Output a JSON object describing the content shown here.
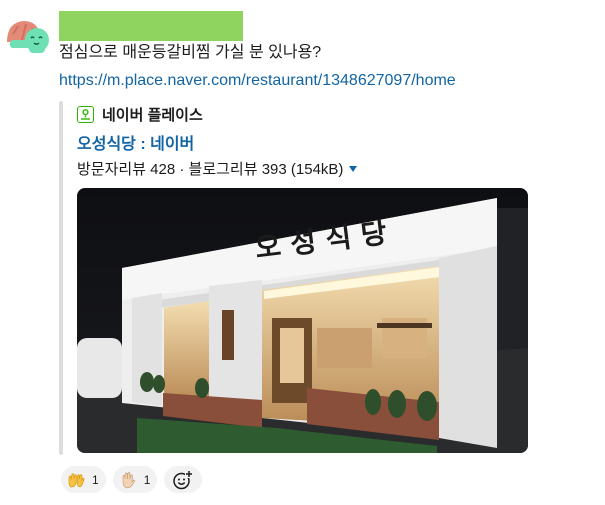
{
  "message": {
    "text": "점심으로 매운등갈비찜 가실 분 있나용?",
    "link": "https://m.place.naver.com/restaurant/1348627097/home"
  },
  "unfurl": {
    "site_name": "네이버 플레이스",
    "title": "오성식당 : 네이버",
    "description": "방문자리뷰 428 · 블로그리뷰 393 (154kB)",
    "sign_text": "오 성 식 당"
  },
  "reactions": [
    {
      "icon": "raised-hands-icon",
      "count": "1"
    },
    {
      "icon": "raised-hand-icon",
      "count": "1"
    }
  ],
  "colors": {
    "link": "#1264a3",
    "name_redaction": "#8fd45f",
    "naver_green": "#2db400"
  }
}
